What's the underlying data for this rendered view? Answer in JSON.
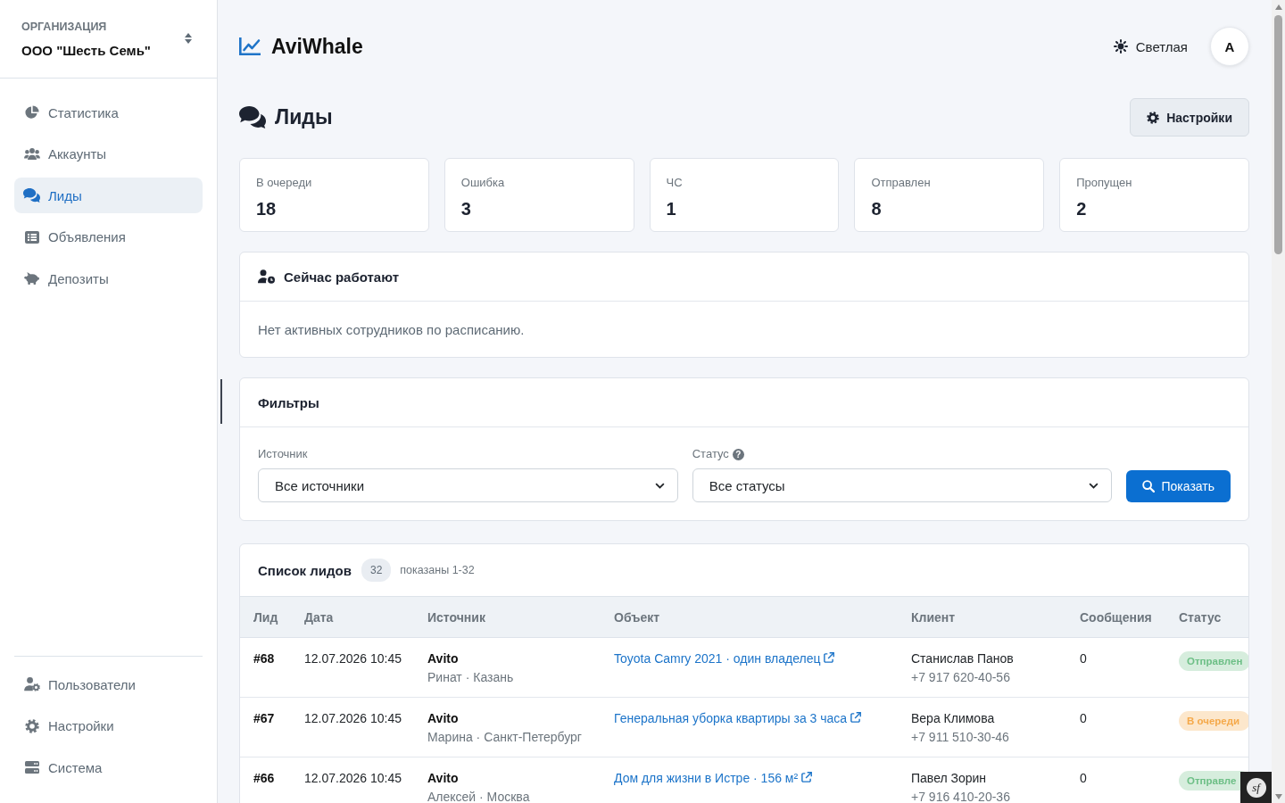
{
  "sidebar": {
    "organization_label": "ОРГАНИЗАЦИЯ",
    "organization_name": "ООО \"Шесть Семь\"",
    "items": [
      {
        "label": "Статистика",
        "selected": false
      },
      {
        "label": "Аккаунты",
        "selected": false
      },
      {
        "label": "Лиды",
        "selected": true
      },
      {
        "label": "Объявления",
        "selected": false
      },
      {
        "label": "Депозиты",
        "selected": false
      }
    ],
    "footer_items": [
      {
        "label": "Пользователи",
        "selected": false
      },
      {
        "label": "Настройки",
        "selected": false
      },
      {
        "label": "Система",
        "selected": false
      }
    ]
  },
  "header": {
    "brand": "AviWhale",
    "theme_toggle": "Светлая",
    "avatar": "A"
  },
  "page": {
    "title": "Лиды",
    "settings_button": "Настройки"
  },
  "stats": [
    {
      "label": "В очереди",
      "value": "18"
    },
    {
      "label": "Ошибка",
      "value": "3"
    },
    {
      "label": "ЧС",
      "value": "1"
    },
    {
      "label": "Отправлен",
      "value": "8"
    },
    {
      "label": "Пропущен",
      "value": "2"
    }
  ],
  "working_now": {
    "title": "Сейчас работают",
    "message": "Нет активных сотрудников по расписанию."
  },
  "filters": {
    "title": "Фильтры",
    "fields": [
      {
        "label": "Источник",
        "value": "Все источники"
      },
      {
        "label": "Статус",
        "value": "Все статусы",
        "help": "?"
      }
    ],
    "submit": "Показать"
  },
  "leads": {
    "title": "Список лидов",
    "count": "32",
    "range": "показаны 1-32",
    "columns": [
      "Лид",
      "Дата",
      "Источник",
      "Объект",
      "Клиент",
      "Сообщения",
      "Статус"
    ],
    "rows": [
      {
        "id": "#68",
        "date": "12.07.2026 10:45",
        "source": "Avito",
        "source_detail": "Ринат · Казань",
        "object": "Toyota Camry 2021 · один владелец",
        "client": "Станислав Панов",
        "phone": "+7 917 620-40-56",
        "messages": "0",
        "status": "Отправлен",
        "color": "#6dbf86"
      },
      {
        "id": "#67",
        "date": "12.07.2026 10:45",
        "source": "Avito",
        "source_detail": "Марина · Санкт-Петербург",
        "object": "Генеральная уборка квартиры за 3 часа",
        "client": "Вера Климова",
        "phone": "+7 911 510-30-46",
        "messages": "0",
        "status": "В очереди",
        "color": "#f5a94a"
      },
      {
        "id": "#66",
        "date": "12.07.2026 10:45",
        "source": "Avito",
        "source_detail": "Алексей · Москва",
        "object": "Дом для жизни в Истре · 156 м²",
        "client": "Павел Зорин",
        "phone": "+7 916 410-20-36",
        "messages": "0",
        "status": "Отправле",
        "color": "#6dbf86"
      }
    ]
  },
  "debug_toolbar": "sf"
}
